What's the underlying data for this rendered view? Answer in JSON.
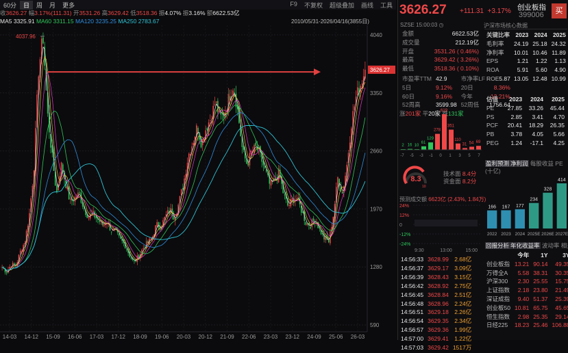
{
  "toolbar": {
    "items": [
      "60分",
      "日",
      "周",
      "月",
      "更多"
    ],
    "active": "日",
    "right": [
      "F9",
      "不复权",
      "超级叠加",
      "画线",
      "工具"
    ]
  },
  "info": {
    "close_label": "收",
    "close": "3626.27",
    "change_label": "幅",
    "change": "3.17%(111.31)",
    "open_label": "开",
    "open": "3531.26",
    "high_label": "高",
    "high": "3629.42",
    "low_label": "低",
    "low": "3518.36",
    "amp_label": "振",
    "amp": "4.07%",
    "turnover_label": "振",
    "turnover": "3.16%",
    "volume_label": "额",
    "volume": "6622.53亿"
  },
  "ma": [
    {
      "name": "MA5",
      "value": "3325.91",
      "color": "#e6e6e6"
    },
    {
      "name": "MA10",
      "value": "3311.15",
      "color": "#e8c23a"
    },
    {
      "name": "MA20",
      "value": "",
      "color": "#e63acb"
    },
    {
      "name": "MA60",
      "value": "3311.15",
      "color": "#2fc75a"
    },
    {
      "name": "MA120",
      "value": "3235.25",
      "color": "#2f8fe0"
    },
    {
      "name": "MA250",
      "value": "2783.67",
      "color": "#2ec4d6"
    }
  ],
  "ma_line": {
    "l1": "MA5 3325.91",
    "l2": "MA60 3311.15",
    "l3": "MA120 3235.25",
    "l4": "MA250 2783.67"
  },
  "range_label": "2010/05/31-2026/04/16(3855日)",
  "chart_data": {
    "type": "candlestick",
    "y_ticks": [
      4040,
      3350,
      2660,
      1970,
      1280,
      590
    ],
    "x_ticks": [
      "14-03",
      "14-12",
      "15-09",
      "16-06",
      "17-03",
      "17-12",
      "18-09",
      "19-06",
      "20-03",
      "20-12",
      "21-09",
      "22-06",
      "23-03",
      "23-12",
      "24-09",
      "25-06",
      "26-03"
    ],
    "peak_label": "4037.96",
    "ylim": [
      590,
      4040
    ],
    "series_close": [
      1280,
      1220,
      1310,
      1290,
      1460,
      1580,
      1900,
      2450,
      3600,
      4037,
      3100,
      2600,
      2150,
      2500,
      2280,
      2050,
      2100,
      2150,
      1980,
      1880,
      1910,
      1850,
      1780,
      1830,
      1720,
      1700,
      1600,
      1550,
      1430,
      1330,
      1400,
      1500,
      1560,
      1620,
      1780,
      1760,
      1880,
      1960,
      1870,
      2050,
      2280,
      2600,
      2760,
      2950,
      2740,
      2950,
      3050,
      3250,
      3050,
      3100,
      3300,
      3450,
      3100,
      2650,
      2500,
      2650,
      2700,
      2580,
      2420,
      2250,
      2300,
      2400,
      2150,
      2000,
      2080,
      2100,
      1950,
      1800,
      1780,
      1850,
      1720,
      1620,
      1580,
      1900,
      2350,
      2150,
      2500,
      3000,
      3300,
      3450,
      3626
    ]
  },
  "title": {
    "name": "创业板指",
    "price": "3626.27",
    "change": "+111.31",
    "pct": "+3.17%",
    "code": "399006",
    "buy": "买",
    "exchange": "SZSE",
    "time": "15:00:03",
    "market": "沪深市场核心数据"
  },
  "stats": [
    {
      "k": "金额",
      "v": "6622.53亿",
      "c": "white"
    },
    {
      "k": "成交量",
      "v": "212.19亿",
      "c": "white"
    },
    {
      "k": "开盘",
      "v": "3531.26 ( 0.46%)",
      "c": "red"
    },
    {
      "k": "最高",
      "v": "3629.42 ( 3.26%)",
      "c": "red"
    },
    {
      "k": "最低",
      "v": "3518.36 ( 0.10%)",
      "c": "red"
    }
  ],
  "stats2": [
    [
      "市盈率TTM",
      "42.9",
      "市净率LF",
      "5.87"
    ],
    [
      "5日",
      "9.12%",
      "20日",
      "8.36%"
    ],
    [
      "60日",
      "9.16%",
      "今年",
      "13.21%"
    ],
    [
      "52周高",
      "3599.98",
      "52周低",
      "1756.64"
    ]
  ],
  "updown": {
    "up_label": "涨",
    "up": "201家",
    "flat_label": "平",
    "flat": "20家",
    "down_label": "跌",
    "down": "131家"
  },
  "dist": {
    "labels": [
      "-7",
      "-5",
      "-3",
      "-1",
      "0",
      "1",
      "3",
      "5",
      "7"
    ],
    "values": [
      2,
      16,
      10,
      61,
      129,
      278,
      619,
      351,
      110,
      31,
      54,
      69
    ],
    "colors": [
      "g",
      "g",
      "g",
      "g",
      "g",
      "r",
      "r",
      "r",
      "r",
      "r",
      "r",
      "r"
    ]
  },
  "gauge": {
    "score": "8.3",
    "max": "10",
    "tech_label": "技术面",
    "tech": "8.4分",
    "fund_label": "资金面",
    "fund": "8.2分"
  },
  "forecast": {
    "label": "预测成交额",
    "value": "6623亿 (2.43%, 1.84万)",
    "times": [
      "9:30",
      "13:00",
      "15:00"
    ],
    "pcts": [
      "24%",
      "12%",
      "0",
      "-12%",
      "-24%"
    ]
  },
  "ticks": [
    [
      "14:56:33",
      "3628.99",
      "2.68亿"
    ],
    [
      "14:56:37",
      "3629.17",
      "3.09亿"
    ],
    [
      "14:56:39",
      "3628.43",
      "3.15亿"
    ],
    [
      "14:56:42",
      "3628.92",
      "2.75亿"
    ],
    [
      "14:56:45",
      "3628.84",
      "2.51亿"
    ],
    [
      "14:56:48",
      "3628.96",
      "2.24亿"
    ],
    [
      "14:56:51",
      "3629.18",
      "2.26亿"
    ],
    [
      "14:56:54",
      "3629.35",
      "2.34亿"
    ],
    [
      "14:56:57",
      "3629.36",
      "1.99亿"
    ],
    [
      "14:57:00",
      "3629.41",
      "1.22亿"
    ],
    [
      "14:57:03",
      "3629.42",
      "1517万"
    ]
  ],
  "metrics": {
    "title": "关键比率",
    "years": [
      "2023",
      "2024",
      "2025"
    ],
    "rows": [
      [
        "毛利率",
        "24.19",
        "25.18",
        "24.32"
      ],
      [
        "净利率",
        "10.01",
        "10.46",
        "11.89"
      ],
      [
        "EPS",
        "1.21",
        "1.22",
        "1.13"
      ],
      [
        "ROA",
        "5.91",
        "5.60",
        "4.90"
      ],
      [
        "ROE",
        "13.05",
        "12.48",
        "10.99"
      ]
    ]
  },
  "valuation": {
    "title": "估值",
    "years": [
      "2023",
      "2024",
      "2025"
    ],
    "rows": [
      [
        "PE",
        "27.85",
        "33.26",
        "45.44"
      ],
      [
        "PS",
        "2.85",
        "3.41",
        "4.70"
      ],
      [
        "PCF",
        "20.41",
        "18.29",
        "26.35"
      ],
      [
        "PB",
        "3.78",
        "4.05",
        "5.66"
      ],
      [
        "PEG",
        "1.24",
        "-17.1",
        "4.25"
      ]
    ]
  },
  "profit": {
    "tabs": [
      "盈利预测",
      "净利润",
      "每股收益",
      "PE"
    ],
    "unit": "(十亿)",
    "years": [
      "2022",
      "2023",
      "2024",
      "2025E",
      "2026E",
      "2027E"
    ],
    "values": [
      166,
      167,
      177,
      234,
      328,
      414
    ]
  },
  "returns": {
    "tabs": [
      "回报分析",
      "年化收益率",
      "波动率",
      "相关性"
    ],
    "head": [
      "今年",
      "1Y",
      "3Y"
    ],
    "rows": [
      [
        "创业板指",
        "13.21",
        "90.14",
        "49.35"
      ],
      [
        "万得全A",
        "5.58",
        "38.31",
        "30.35"
      ],
      [
        "沪深300",
        "2.30",
        "25.55",
        "15.75"
      ],
      [
        "上证指数",
        "2.18",
        "23.80",
        "21.49"
      ],
      [
        "深证成指",
        "9.40",
        "51.37",
        "25.39"
      ],
      [
        "创业板50",
        "10.81",
        "65.75",
        "45.65"
      ],
      [
        "恒生指数",
        "2.98",
        "25.35",
        "29.14"
      ],
      [
        "日经225",
        "18.23",
        "25.46",
        "106.88"
      ]
    ]
  }
}
